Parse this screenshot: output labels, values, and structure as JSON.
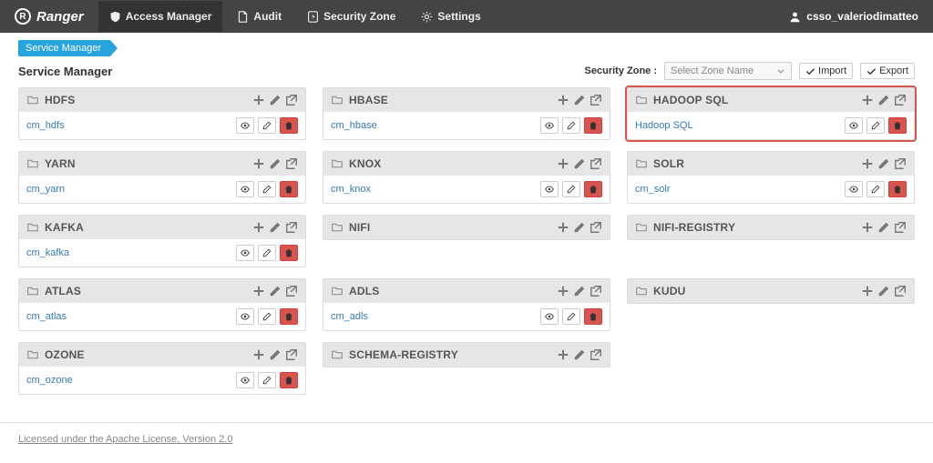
{
  "brand": "Ranger",
  "nav": {
    "access": "Access Manager",
    "audit": "Audit",
    "zone": "Security Zone",
    "settings": "Settings"
  },
  "user": "csso_valeriodimatteo",
  "breadcrumb": "Service Manager",
  "page_title": "Service Manager",
  "zone_picker": {
    "label": "Security Zone :",
    "placeholder": "Select Zone Name"
  },
  "io": {
    "import": "Import",
    "export": "Export"
  },
  "cards": [
    {
      "title": "HDFS",
      "service": "cm_hdfs",
      "highlight": false
    },
    {
      "title": "HBASE",
      "service": "cm_hbase",
      "highlight": false
    },
    {
      "title": "HADOOP SQL",
      "service": "Hadoop SQL",
      "highlight": true
    },
    {
      "title": "YARN",
      "service": "cm_yarn",
      "highlight": false
    },
    {
      "title": "KNOX",
      "service": "cm_knox",
      "highlight": false
    },
    {
      "title": "SOLR",
      "service": "cm_solr",
      "highlight": false
    },
    {
      "title": "KAFKA",
      "service": "cm_kafka",
      "highlight": false
    },
    {
      "title": "NIFI",
      "service": null,
      "highlight": false
    },
    {
      "title": "NIFI-REGISTRY",
      "service": null,
      "highlight": false
    },
    {
      "title": "ATLAS",
      "service": "cm_atlas",
      "highlight": false
    },
    {
      "title": "ADLS",
      "service": "cm_adls",
      "highlight": false
    },
    {
      "title": "KUDU",
      "service": null,
      "highlight": false
    },
    {
      "title": "OZONE",
      "service": "cm_ozone",
      "highlight": false
    },
    {
      "title": "SCHEMA-REGISTRY",
      "service": null,
      "highlight": false
    }
  ],
  "footer": "Licensed under the Apache License, Version 2.0"
}
